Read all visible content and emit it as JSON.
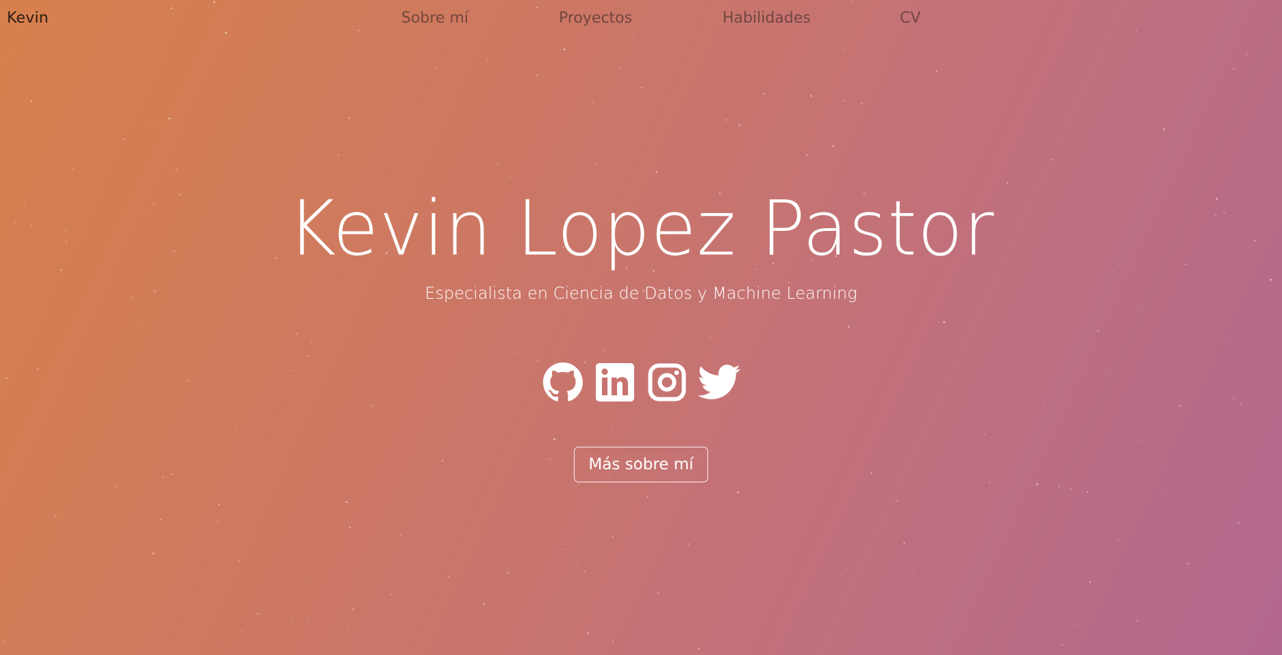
{
  "navbar": {
    "brand": "Kevin",
    "links": [
      {
        "label": "Sobre mí"
      },
      {
        "label": "Proyectos"
      },
      {
        "label": "Habilidades"
      },
      {
        "label": "CV"
      }
    ]
  },
  "hero": {
    "title": "Kevin Lopez Pastor",
    "subtitle": "Especialista en Ciencia de Datos y Machine Learning",
    "cta_label": "Más sobre mí"
  },
  "socials": [
    {
      "icon": "github-icon"
    },
    {
      "icon": "linkedin-icon"
    },
    {
      "icon": "instagram-icon"
    },
    {
      "icon": "twitter-icon"
    }
  ],
  "colors": {
    "gradient_start": "#d8804c",
    "gradient_end": "#b3688f",
    "foreground": "#ffffff",
    "brand_text": "#2a1a14"
  }
}
